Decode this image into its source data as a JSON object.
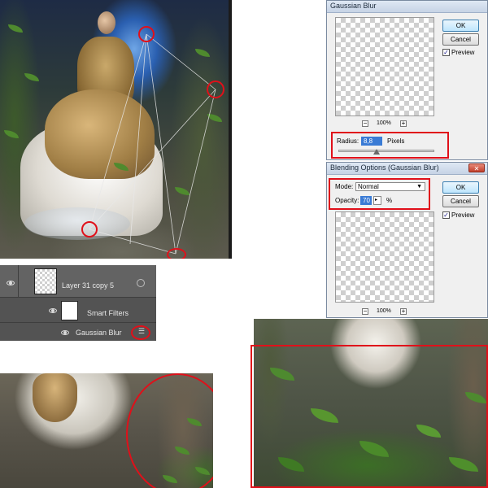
{
  "gaussian_dialog": {
    "title": "Gaussian Blur",
    "ok_label": "OK",
    "cancel_label": "Cancel",
    "preview_label": "Preview",
    "preview_checked": true,
    "zoom_minus": "−",
    "zoom_value": "100%",
    "zoom_plus": "+",
    "radius_label": "Radius:",
    "radius_value": "8,8",
    "radius_unit": "Pixels",
    "radius_slider_fraction": 0.4
  },
  "blending_dialog": {
    "title": "Blending Options (Gaussian Blur)",
    "ok_label": "OK",
    "cancel_label": "Cancel",
    "preview_label": "Preview",
    "preview_checked": true,
    "mode_label": "Mode:",
    "mode_value": "Normal",
    "opacity_label": "Opacity:",
    "opacity_value": "70",
    "opacity_unit": "%",
    "zoom_minus": "−",
    "zoom_value": "100%",
    "zoom_plus": "+"
  },
  "layers_panel": {
    "layer_name": "Layer 31 copy 5",
    "smart_filters_label": "Smart Filters",
    "filter_name": "Gaussian Blur"
  },
  "annotation_color": "#e0101a"
}
